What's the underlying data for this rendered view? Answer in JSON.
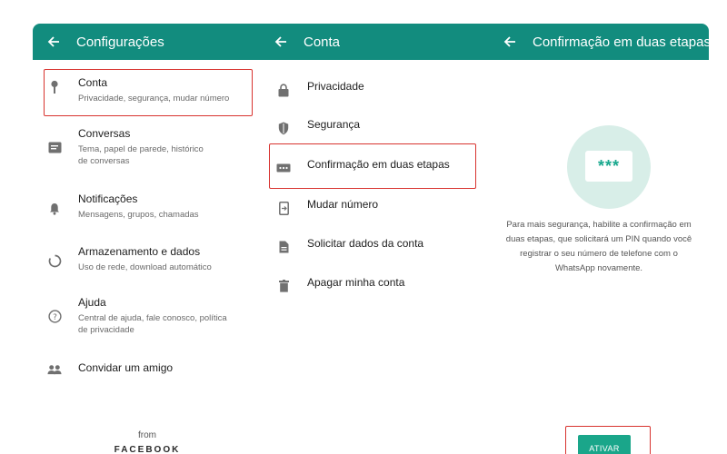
{
  "panel1": {
    "title": "Configurações",
    "items": [
      {
        "title": "Conta",
        "subtitle": "Privacidade, segurança, mudar número",
        "icon": "key-icon"
      },
      {
        "title": "Conversas",
        "subtitle": "Tema, papel de parede, histórico de conversas",
        "icon": "chat-icon"
      },
      {
        "title": "Notificações",
        "subtitle": "Mensagens, grupos, chamadas",
        "icon": "bell-icon"
      },
      {
        "title": "Armazenamento e dados",
        "subtitle": "Uso de rede, download automático",
        "icon": "data-usage-icon"
      },
      {
        "title": "Ajuda",
        "subtitle": "Central de ajuda, fale conosco, política de privacidade",
        "icon": "help-icon"
      },
      {
        "title": "Convidar um amigo",
        "subtitle": "",
        "icon": "people-icon"
      }
    ],
    "footer_from": "from",
    "footer_brand": "FACEBOOK"
  },
  "panel2": {
    "title": "Conta",
    "items": [
      {
        "title": "Privacidade",
        "icon": "lock-icon"
      },
      {
        "title": "Segurança",
        "icon": "shield-icon"
      },
      {
        "title": "Confirmação em duas etapas",
        "icon": "dots-icon"
      },
      {
        "title": "Mudar número",
        "icon": "phone-change-icon"
      },
      {
        "title": "Solicitar dados da conta",
        "icon": "document-icon"
      },
      {
        "title": "Apagar minha conta",
        "icon": "trash-icon"
      }
    ]
  },
  "panel3": {
    "title": "Confirmação em duas etapas",
    "pin_mask": "***",
    "description": "Para mais segurança, habilite a confirmação em duas etapas, que solicitará um PIN quando você registrar o seu número de telefone com o WhatsApp novamente.",
    "button_label": "ATIVAR"
  },
  "colors": {
    "header": "#128c7e",
    "accent": "#1aa68a",
    "highlight": "#d8332f"
  }
}
